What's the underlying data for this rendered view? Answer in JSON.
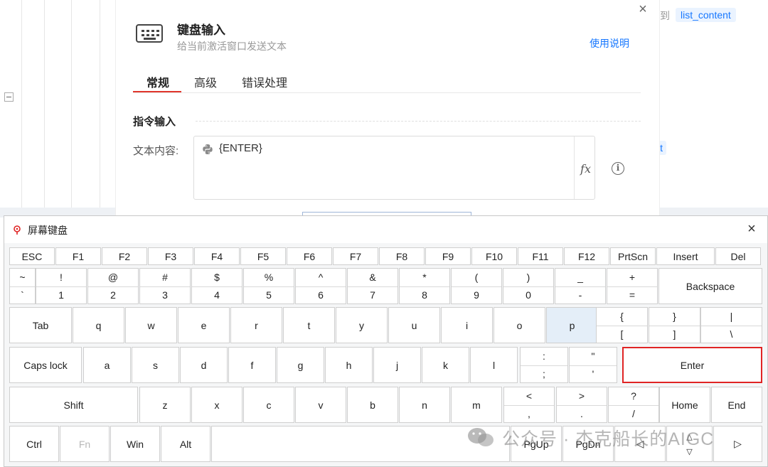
{
  "background": {
    "snippet_left": "到",
    "tag_top": "list_content",
    "tag_mid": "lt"
  },
  "dialog": {
    "title": "键盘输入",
    "subtitle": "给当前激活窗口发送文本",
    "help_link": "使用说明",
    "close_icon": "×",
    "tabs": [
      "常规",
      "高级",
      "错误处理"
    ],
    "active_tab": "常规",
    "section_title": "指令输入",
    "field_label": "文本内容:",
    "text_value": "{ENTER}",
    "fx_label": "fx",
    "info_glyph": "i"
  },
  "keyboard": {
    "title": "屏幕键盘",
    "close_icon": "×",
    "function_row": [
      "ESC",
      "F1",
      "F2",
      "F3",
      "F4",
      "F5",
      "F6",
      "F7",
      "F8",
      "F9",
      "F10",
      "F11",
      "F12",
      "PrtScn",
      "Insert",
      "Del"
    ],
    "number_row": [
      {
        "top": "~",
        "bottom": "`"
      },
      {
        "top": "!",
        "bottom": "1"
      },
      {
        "top": "@",
        "bottom": "2"
      },
      {
        "top": "#",
        "bottom": "3"
      },
      {
        "top": "$",
        "bottom": "4"
      },
      {
        "top": "%",
        "bottom": "5"
      },
      {
        "top": "^",
        "bottom": "6"
      },
      {
        "top": "&",
        "bottom": "7"
      },
      {
        "top": "*",
        "bottom": "8"
      },
      {
        "top": "(",
        "bottom": "9"
      },
      {
        "top": ")",
        "bottom": "0"
      },
      {
        "top": "_",
        "bottom": "-"
      },
      {
        "top": "+",
        "bottom": "="
      }
    ],
    "backspace": "Backspace",
    "tab": "Tab",
    "qwerty_row": [
      "q",
      "w",
      "e",
      "r",
      "t",
      "y",
      "u",
      "i",
      "o",
      "p"
    ],
    "bracket_keys": [
      {
        "top": "{",
        "bottom": "["
      },
      {
        "top": "}",
        "bottom": "]"
      },
      {
        "top": "|",
        "bottom": "\\"
      }
    ],
    "caps_lock": "Caps lock",
    "home_row": [
      "a",
      "s",
      "d",
      "f",
      "g",
      "h",
      "j",
      "k",
      "l"
    ],
    "colon_keys": [
      {
        "top": ":",
        "bottom": ";"
      },
      {
        "top": "\"",
        "bottom": "'"
      }
    ],
    "enter": "Enter",
    "shift": "Shift",
    "bottom_letters": [
      "z",
      "x",
      "c",
      "v",
      "b",
      "n",
      "m"
    ],
    "punct_keys": [
      {
        "top": "<",
        "bottom": ","
      },
      {
        "top": ">",
        "bottom": "."
      },
      {
        "top": "?",
        "bottom": "/"
      }
    ],
    "home": "Home",
    "end": "End",
    "ctrl": "Ctrl",
    "fn": "Fn",
    "win": "Win",
    "alt": "Alt",
    "pgup": "PgUp",
    "pgdn": "PgDn",
    "arrow_left": "◁",
    "arrow_up": "△",
    "arrow_down": "▽",
    "arrow_right": "▷",
    "highlighted_key": "p",
    "highlighted_box_key": "Enter"
  },
  "watermark": "公众号 · 杰克船长的AIGC"
}
